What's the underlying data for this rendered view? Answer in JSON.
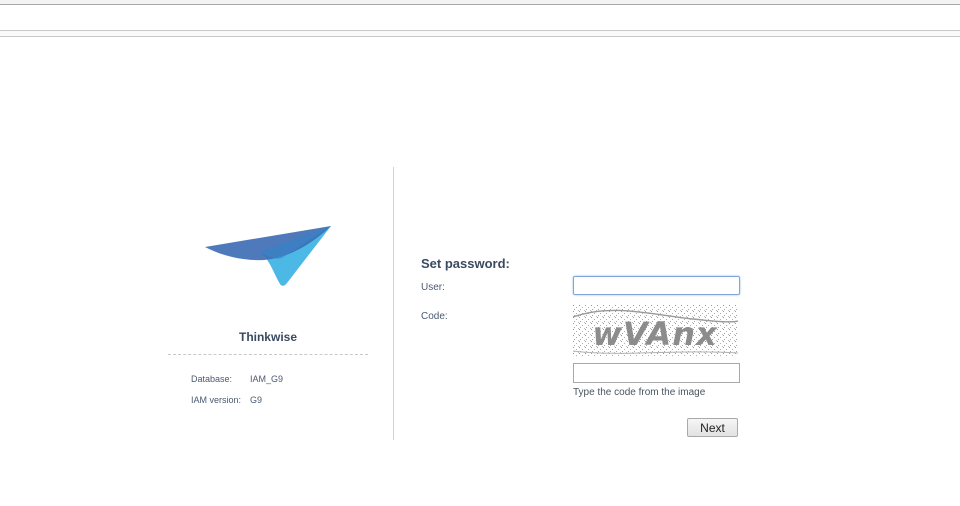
{
  "brand": {
    "name": "Thinkwise",
    "logo_icon": "paper-plane-logo",
    "colors": {
      "dark": "#3f6fb5",
      "light": "#4cb8e6"
    }
  },
  "info": {
    "database_label": "Database:",
    "database_value": "IAM_G9",
    "version_label": "IAM version:",
    "version_value": "G9"
  },
  "form": {
    "title": "Set password:",
    "user_label": "User:",
    "user_value": "",
    "code_label": "Code:",
    "captcha_text": "wVAnx",
    "code_value": "",
    "code_hint": "Type the code from the image",
    "next_label": "Next"
  }
}
